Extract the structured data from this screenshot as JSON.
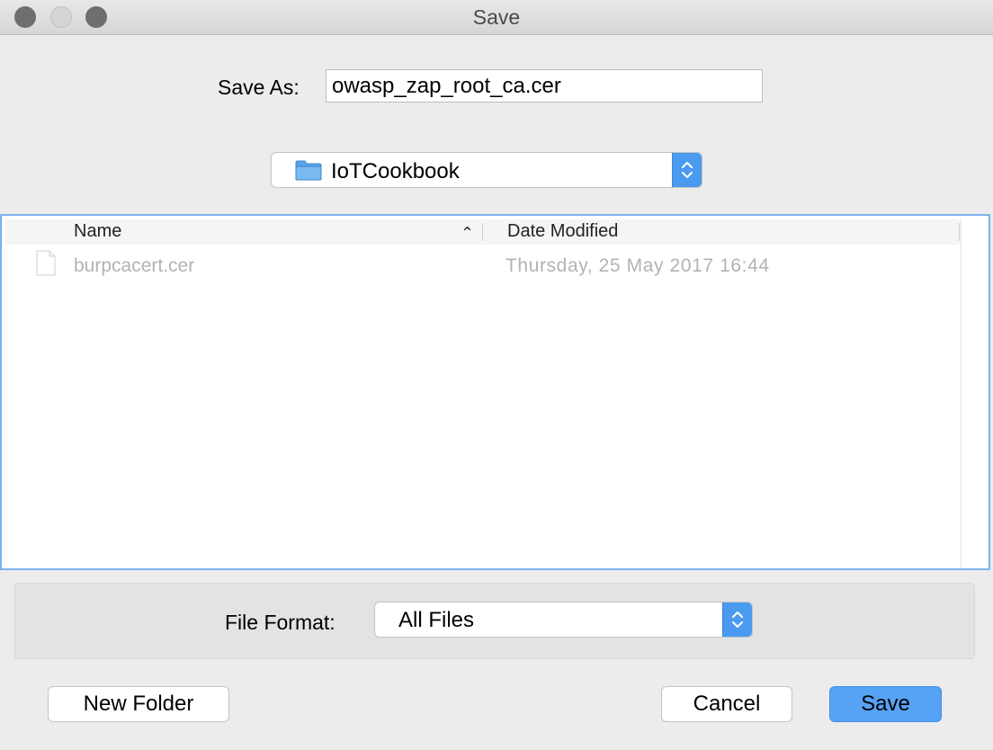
{
  "window": {
    "title": "Save"
  },
  "save_as": {
    "label": "Save As:",
    "value": "owasp_zap_root_ca.cer"
  },
  "location": {
    "folder": "IoTCookbook",
    "icon": "folder-icon"
  },
  "file_list": {
    "columns": {
      "name": "Name",
      "date_modified": "Date Modified"
    },
    "sort_indicator": "^",
    "rows": [
      {
        "name": "burpcacert.cer",
        "date": "Thursday, 25 May 2017 16:44",
        "icon": "document-icon"
      }
    ]
  },
  "file_format": {
    "label": "File Format:",
    "value": "All Files"
  },
  "buttons": {
    "new_folder": "New Folder",
    "cancel": "Cancel",
    "save": "Save"
  },
  "colors": {
    "accent": "#4a9bf0",
    "focus_ring": "#7cb2ee",
    "disabled_text": "#b3b3b3"
  }
}
